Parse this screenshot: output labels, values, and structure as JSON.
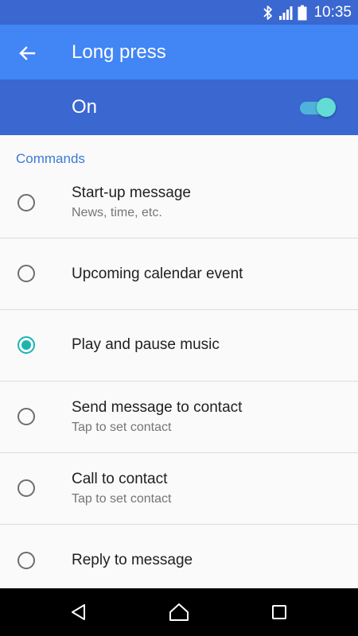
{
  "status_bar": {
    "time": "10:35",
    "icons": [
      "bluetooth-icon",
      "signal-icon",
      "battery-icon"
    ],
    "background": "#3a67d0"
  },
  "toolbar": {
    "title": "Long press",
    "back_icon": "arrow-back-icon",
    "background": "#4285f4"
  },
  "master_switch": {
    "label": "On",
    "checked": true,
    "accent": "#64dcd6"
  },
  "commands": {
    "header": "Commands",
    "selected_index": 2,
    "items": [
      {
        "title": "Start-up message",
        "subtitle": "News, time, etc.",
        "checked": false
      },
      {
        "title": "Upcoming calendar event",
        "subtitle": "",
        "checked": false
      },
      {
        "title": "Play and pause music",
        "subtitle": "",
        "checked": true
      },
      {
        "title": "Send message to contact",
        "subtitle": "Tap to set contact",
        "checked": false
      },
      {
        "title": "Call to contact",
        "subtitle": "Tap to set contact",
        "checked": false
      },
      {
        "title": "Reply to message",
        "subtitle": "",
        "checked": false
      }
    ]
  },
  "nav_bar": {
    "buttons": [
      "back-triangle-icon",
      "home-icon",
      "recents-icon"
    ]
  }
}
